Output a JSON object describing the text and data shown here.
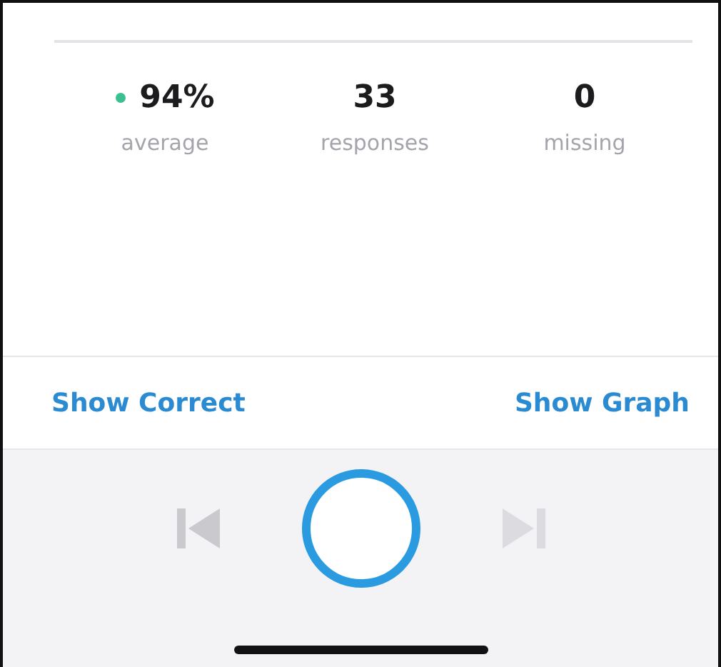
{
  "stats": [
    {
      "value": "94%",
      "label": "average",
      "color": "#3cc08f"
    },
    {
      "value": "33",
      "label": "responses"
    },
    {
      "value": "0",
      "label": "missing"
    }
  ],
  "actions": [
    {
      "label": "Show Correct"
    },
    {
      "label": "Show Graph"
    }
  ]
}
